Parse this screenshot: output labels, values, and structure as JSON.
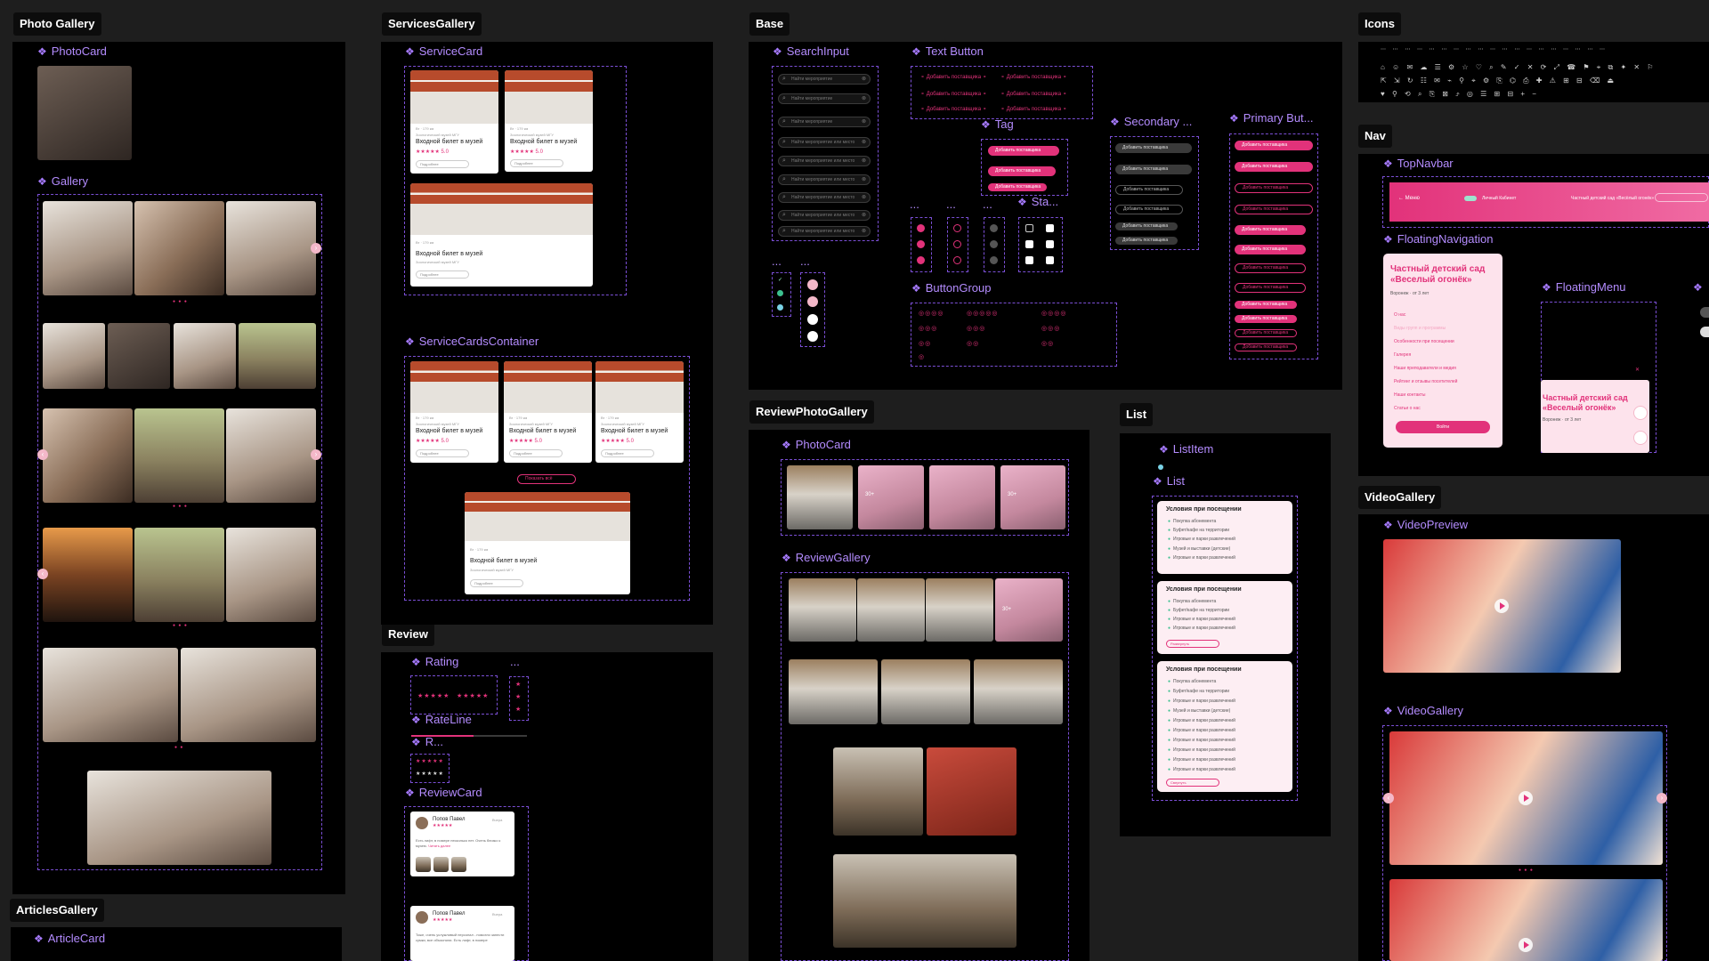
{
  "sections": {
    "photo_gallery": "Photo Gallery",
    "services_gallery": "ServicesGallery",
    "base": "Base",
    "icons": "Icons",
    "nav": "Nav",
    "review_photo_gallery": "ReviewPhotoGallery",
    "list": "List",
    "review": "Review",
    "video_gallery": "VideoGallery",
    "articles_gallery": "ArticlesGallery"
  },
  "components": {
    "photo_card": "PhotoCard",
    "gallery": "Gallery",
    "service_card": "ServiceCard",
    "service_cards_container": "ServiceCardsContainer",
    "search_input": "SearchInput",
    "text_button": "Text Button",
    "tag": "Tag",
    "secondary": "Secondary ...",
    "primary": "Primary But...",
    "status": "Sta...",
    "button_group": "ButtonGroup",
    "top_navbar": "TopNavbar",
    "floating_navigation": "FloatingNavigation",
    "floating_menu": "FloatingMenu",
    "review_photo_card": "PhotoCard",
    "review_gallery": "ReviewGallery",
    "list_item": "ListItem",
    "list": "List",
    "rating": "Rating",
    "rate_line": "RateLine",
    "r_short": "R...",
    "review_card": "ReviewCard",
    "video_preview": "VideoPreview",
    "video_gallery": "VideoGallery",
    "article_card": "ArticleCard",
    "ellipsis": "..."
  },
  "service_card": {
    "meta_line": "Вт   ·   179 км",
    "museum": "Зоологический музей МГУ",
    "title": "Входной билет в музей",
    "rating": "★★★★★  5.0",
    "button": "Подробнее",
    "show_all": "Показать всё"
  },
  "search": {
    "placeholder_1": "Найти мероприятие",
    "placeholder_2": "Найти мероприятие или место"
  },
  "buttons": {
    "add_label": "Добавить поставщика"
  },
  "nav": {
    "menu": "Меню",
    "center": "Личный Кабинет",
    "right": "Частный детский сад «Весёлый огонёк»"
  },
  "floating_nav": {
    "title": "Частный детский сад «Веселый огонёк»",
    "subtitle": "Воронеж  ·  от 3 лет",
    "items": [
      "О нас",
      "Виды групп и программы",
      "Особенности при посещении",
      "Галерея",
      "Наши преподаватели и медия",
      "Рейтинг и отзывы посетителей",
      "Наши контакты",
      "Статьи о нас"
    ],
    "cta": "Войти"
  },
  "floating_menu": {
    "title": "Частный детский сад «Веселый огонёк»",
    "subtitle": "Воронеж  ·  от 3 лет"
  },
  "review_gallery": {
    "badge": "30+"
  },
  "list": {
    "title": "Условия при посещении",
    "items": [
      "Покупка абонемента",
      "Буфет/кафе на территории",
      "Игровые и парки развлечений",
      "Музей и выставки (детские)",
      "Игровые и парки развлечений"
    ],
    "more": "Развернуть",
    "collapse": "Свернуть"
  },
  "review": {
    "author": "Попов Павел",
    "date": "Вчера",
    "text": "Есть лифт, в номере несколько нет. Очень близко к музею.",
    "text_link": "Читать далее",
    "text2": "Тоже, очень услужливый персонал - помогли занести сумки, все объяснили. Есть лифт, в номере"
  },
  "icons_rows": [
    "⋯ ⋯ ⋯ ⋯ ⋯ ⋯ ⋯ ⋯ ⋯ ⋯ ⋯ ⋯ ⋯ ⋯ ⋯ ⋯ ⋯ ⋯ ⋯",
    "⌂ ☺ ✉ ☁ ☰ ⚙ ☆ ♡ ⌕ ✎ ✓ ✕ ⟳ ⤢ ☎ ⚑ ⌖ ⧉ ✦ ✕ ⚐",
    "⇱ ⇲ ↻ ☷ ✉ ⌁ ⚲ ⌖ ⚙ ⎘ ⌬ ⎙ ✚ ⚠ ⊞ ⊟ ⌫ ⏏",
    "♥ ⚲ ⟲ ⌕ ⎘ ⊠ ⤴ ◎ ☰ ⊞ ⊟ + −"
  ],
  "colors": {
    "accent": "#e2327a",
    "label": "#b48cff",
    "canvas": "#1e1e1e",
    "panel": "#000000"
  }
}
